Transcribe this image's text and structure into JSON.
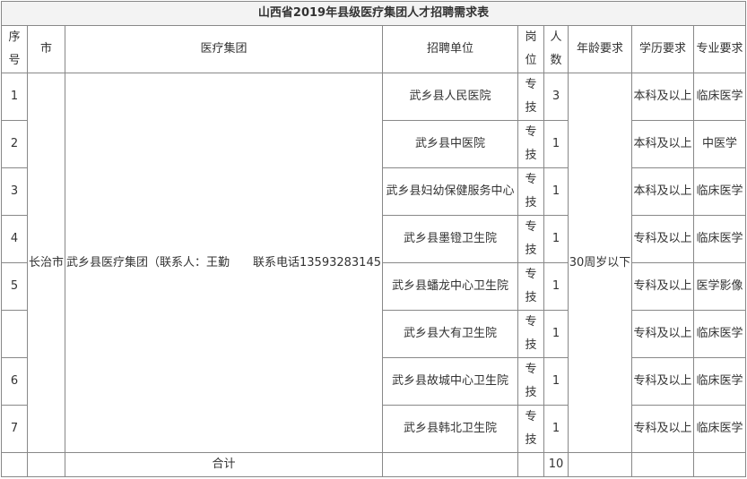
{
  "title": "山西省2019年县级医疗集团人才招聘需求表",
  "headers": {
    "seq": "序号",
    "city": "市",
    "group": "医疗集团",
    "unit": "招聘单位",
    "post": "岗位",
    "count": "人数",
    "age": "年龄要求",
    "edu": "学历要求",
    "major": "专业要求"
  },
  "merged": {
    "city": "长治市",
    "group": "武乡县医疗集团（联系人：王勤　　联系电话13593283145",
    "age": "30周岁以下"
  },
  "rows": [
    {
      "seq": "1",
      "unit": "武乡县人民医院",
      "post": "专技",
      "count": "3",
      "edu": "本科及以上",
      "major": "临床医学"
    },
    {
      "seq": "2",
      "unit": "武乡县中医院",
      "post": "专技",
      "count": "1",
      "edu": "本科及以上",
      "major": "中医学"
    },
    {
      "seq": "3",
      "unit": "武乡县妇幼保健服务中心",
      "post": "专技",
      "count": "1",
      "edu": "本科及以上",
      "major": "临床医学"
    },
    {
      "seq": "4",
      "unit": "武乡县墨镫卫生院",
      "post": "专技",
      "count": "1",
      "edu": "专科及以上",
      "major": "临床医学"
    },
    {
      "seq": "5",
      "unit": "武乡县蟠龙中心卫生院",
      "post": "专技",
      "count": "1",
      "edu": "专科及以上",
      "major": "医学影像"
    },
    {
      "seq": "",
      "unit": "武乡县大有卫生院",
      "post": "专技",
      "count": "1",
      "edu": "专科及以上",
      "major": "临床医学"
    },
    {
      "seq": "6",
      "unit": "武乡县故城中心卫生院",
      "post": "专技",
      "count": "1",
      "edu": "专科及以上",
      "major": "临床医学"
    },
    {
      "seq": "7",
      "unit": "武乡县韩北卫生院",
      "post": "专技",
      "count": "1",
      "edu": "专科及以上",
      "major": "临床医学"
    }
  ],
  "total": {
    "label": "合计",
    "count": "10"
  }
}
